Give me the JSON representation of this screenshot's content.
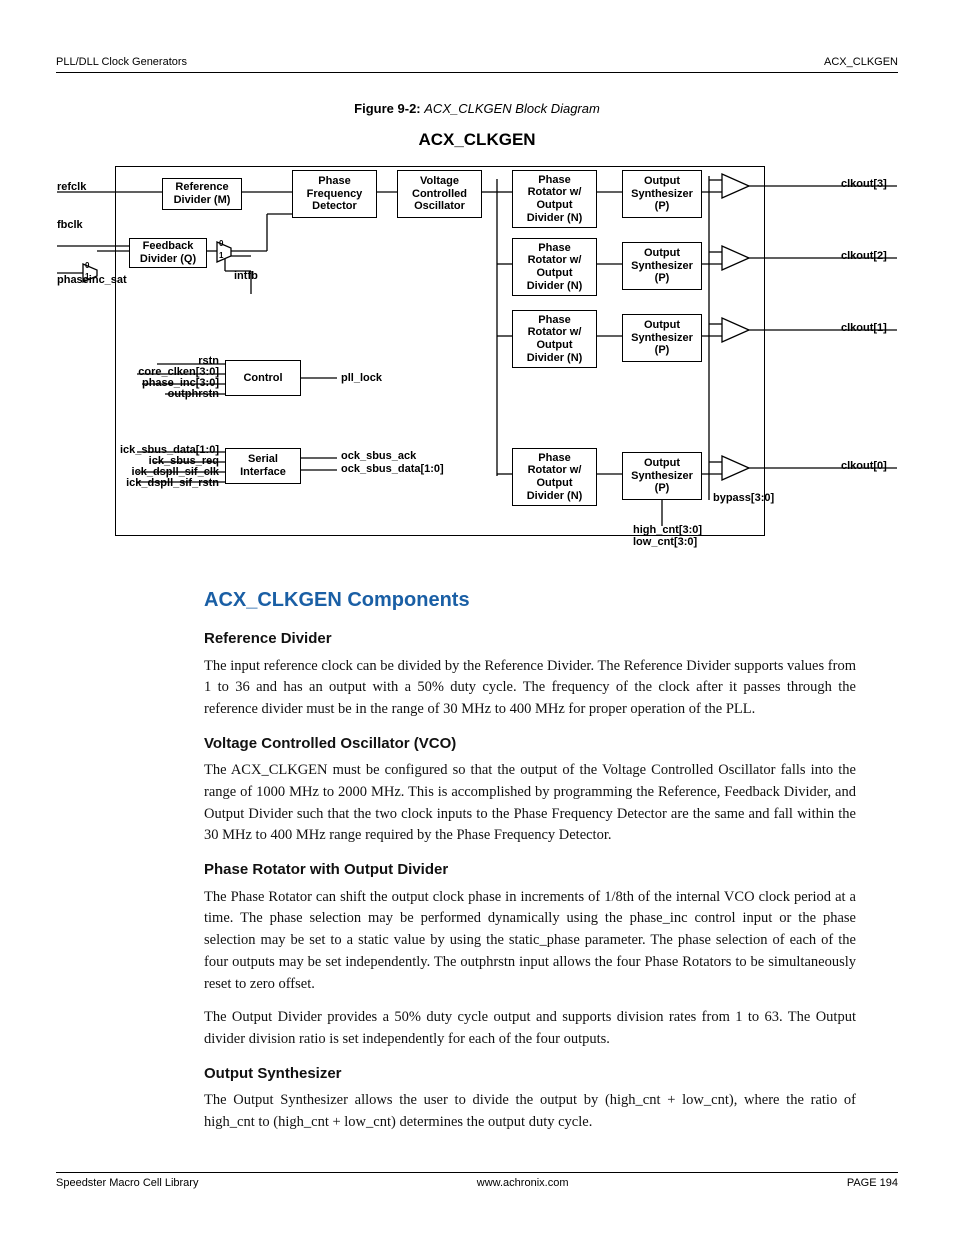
{
  "header": {
    "left": "PLL/DLL Clock Generators",
    "right": "ACX_CLKGEN"
  },
  "figure": {
    "label": "Figure 9-2:",
    "title": "ACX_CLKGEN Block Diagram",
    "diagram_title": "ACX_CLKGEN"
  },
  "diagram": {
    "blocks": {
      "ref_div": "Reference\nDivider (M)",
      "pfd": "Phase\nFrequency\nDetector",
      "vco": "Voltage\nControlled\nOscillator",
      "fb_div": "Feedback\nDivider (Q)",
      "control": "Control",
      "sif": "Serial\nInterface",
      "pr": "Phase\nRotator w/\nOutput\nDivider (N)",
      "os": "Output\nSynthesizer\n(P)"
    },
    "labels": {
      "refclk": "refclk",
      "fbclk": "fbclk",
      "phaseinc_sat": "phaseinc_sat",
      "intfb": "intfb",
      "rstn": "rstn",
      "core_clken": "core_clken[3:0]",
      "phase_inc": "phase_inc[3:0]",
      "outphrstn": "outphrstn",
      "ick_sbus_data": "ick_sbus_data[1:0]",
      "ick_sbus_req": "ick_sbus_req",
      "ick_dspll_sif_clk": "ick_dspll_sif_clk",
      "ick_dspll_sif_rstn": "ick_dspll_sif_rstn",
      "pll_lock": "pll_lock",
      "ock_sbus_ack": "ock_sbus_ack",
      "ock_sbus_data": "ock_sbus_data[1:0]",
      "clkout3": "clkout[3]",
      "clkout2": "clkout[2]",
      "clkout1": "clkout[1]",
      "clkout0": "clkout[0]",
      "bypass": "bypass[3:0]",
      "high_cnt": "high_cnt[3:0]",
      "low_cnt": "low_cnt[3:0]",
      "mux0": "0",
      "mux1": "1"
    }
  },
  "sections": {
    "h2": "ACX_CLKGEN Components",
    "refdiv": {
      "h": "Reference Divider",
      "p": "The input reference clock can be divided by the Reference Divider. The Reference Divider supports values from 1 to 36 and has an output with a 50% duty cycle. The frequency of the clock after it passes through the reference divider must be in the range of 30 MHz to 400 MHz for proper operation of the PLL."
    },
    "vco": {
      "h": "Voltage Controlled Oscillator (VCO)",
      "p": "The ACX_CLKGEN must be configured so that the output of the Voltage Controlled Oscillator falls into the range of 1000 MHz to 2000 MHz. This is accomplished by programming the Reference, Feedback Divider, and Output Divider such that the two clock inputs to the Phase Frequency Detector are the same and fall within the 30 MHz to 400 MHz range required by the Phase Frequency Detector."
    },
    "pr": {
      "h": "Phase Rotator with Output Divider",
      "p1": "The Phase Rotator can shift the output clock phase in increments of 1/8th of the internal VCO clock period at a time. The phase selection may be performed dynamically using the phase_inc control input or the phase selection may be set to a static value by using the static_phase parameter. The phase selection of each of the four outputs may be set independently. The outphrstn input allows the four Phase Rotators to be simultaneously reset to zero offset.",
      "p2": "The Output Divider provides a 50% duty cycle output and supports division rates from 1 to 63. The Output divider division ratio is set independently for each of the four outputs."
    },
    "os": {
      "h": "Output Synthesizer",
      "p": "The Output Synthesizer allows the user to divide the output by (high_cnt + low_cnt), where the ratio of high_cnt to (high_cnt + low_cnt) determines the output duty cycle."
    }
  },
  "footer": {
    "left": "Speedster Macro Cell Library",
    "center": "www.achronix.com",
    "right": "PAGE 194"
  }
}
